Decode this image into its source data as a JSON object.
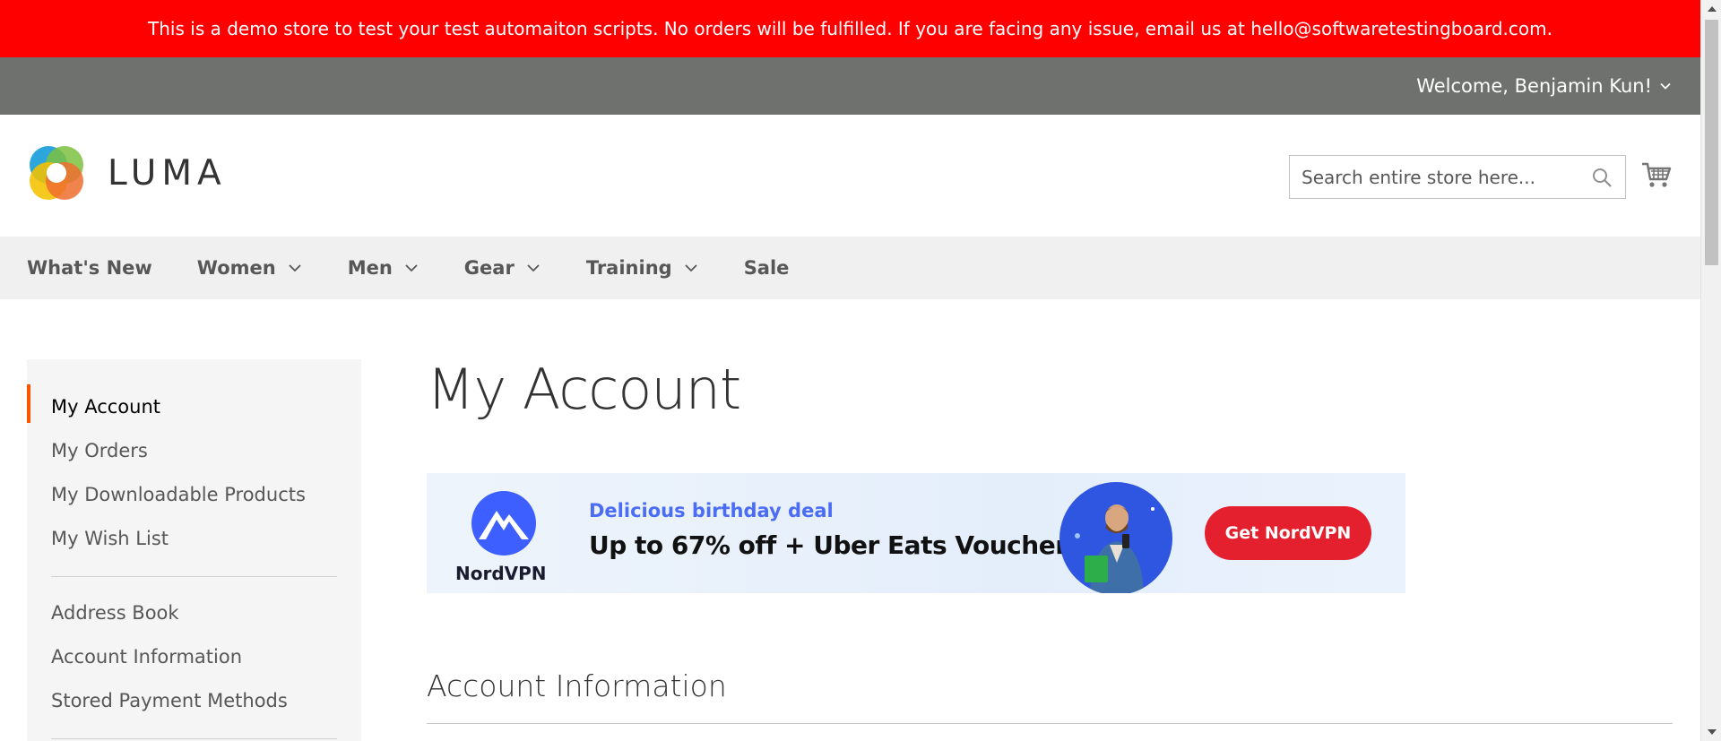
{
  "demo_banner": {
    "text": "This is a demo store to test your test automaiton scripts. No orders will be fulfilled. If you are facing any issue, email us at hello@softwaretestingboard.com.",
    "color": "#ff0000"
  },
  "header": {
    "welcome": "Welcome, Benjamin Kun!",
    "logo_text": "LUMA",
    "search_placeholder": "Search entire store here...",
    "panel_color": "#6e716e"
  },
  "nav": {
    "items": [
      {
        "label": "What's New",
        "has_dropdown": false
      },
      {
        "label": "Women",
        "has_dropdown": true
      },
      {
        "label": "Men",
        "has_dropdown": true
      },
      {
        "label": "Gear",
        "has_dropdown": true
      },
      {
        "label": "Training",
        "has_dropdown": true
      },
      {
        "label": "Sale",
        "has_dropdown": false
      }
    ]
  },
  "sidebar": {
    "groups": [
      [
        "My Account",
        "My Orders",
        "My Downloadable Products",
        "My Wish List"
      ],
      [
        "Address Book",
        "Account Information",
        "Stored Payment Methods"
      ]
    ],
    "current": "My Account",
    "accent_color": "#ff5501"
  },
  "main": {
    "page_title": "My Account",
    "section_title": "Account Information"
  },
  "ad": {
    "brand": "NordVPN",
    "subheadline": "Delicious birthday deal",
    "headline": "Up to 67% off + Uber Eats Voucher",
    "cta": "Get NordVPN",
    "cta_color": "#e5202e"
  }
}
